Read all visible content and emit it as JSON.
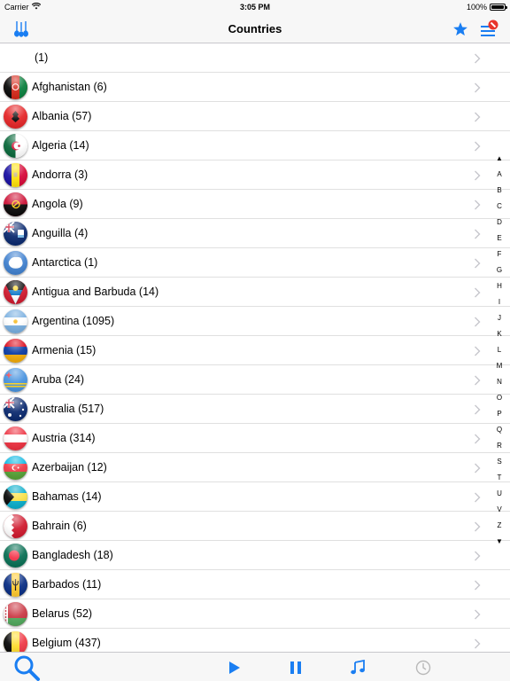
{
  "status": {
    "carrier": "Carrier",
    "time": "3:05 PM",
    "battery": "100%",
    "battery_level": 1.0
  },
  "nav": {
    "title": "Countries",
    "left_icon": "guitars-icon",
    "star_icon": "star-icon",
    "menu_icon": "menu-badge-icon"
  },
  "colors": {
    "accent": "#1a7ef2",
    "separator": "#e0e0e0",
    "chevron": "#c7c7cc"
  },
  "rows": [
    {
      "label": "(1)",
      "flag": "none"
    },
    {
      "label": "Afghanistan (6)",
      "flag": "afghanistan"
    },
    {
      "label": "Albania (57)",
      "flag": "albania"
    },
    {
      "label": "Algeria (14)",
      "flag": "algeria"
    },
    {
      "label": "Andorra (3)",
      "flag": "andorra"
    },
    {
      "label": "Angola (9)",
      "flag": "angola"
    },
    {
      "label": "Anguilla (4)",
      "flag": "anguilla"
    },
    {
      "label": "Antarctica (1)",
      "flag": "antarctica"
    },
    {
      "label": "Antigua and Barbuda (14)",
      "flag": "antigua"
    },
    {
      "label": "Argentina (1095)",
      "flag": "argentina"
    },
    {
      "label": "Armenia (15)",
      "flag": "armenia"
    },
    {
      "label": "Aruba (24)",
      "flag": "aruba"
    },
    {
      "label": "Australia (517)",
      "flag": "australia"
    },
    {
      "label": "Austria (314)",
      "flag": "austria"
    },
    {
      "label": "Azerbaijan (12)",
      "flag": "azerbaijan"
    },
    {
      "label": "Bahamas (14)",
      "flag": "bahamas"
    },
    {
      "label": "Bahrain (6)",
      "flag": "bahrain"
    },
    {
      "label": "Bangladesh (18)",
      "flag": "bangladesh"
    },
    {
      "label": "Barbados (11)",
      "flag": "barbados"
    },
    {
      "label": "Belarus (52)",
      "flag": "belarus"
    },
    {
      "label": "Belgium (437)",
      "flag": "belgium"
    }
  ],
  "index": {
    "up": "▲",
    "down": "▼",
    "letters": [
      "A",
      "B",
      "C",
      "D",
      "E",
      "F",
      "G",
      "H",
      "I",
      "J",
      "K",
      "L",
      "M",
      "N",
      "O",
      "P",
      "Q",
      "R",
      "S",
      "T",
      "U",
      "V",
      "Z"
    ]
  },
  "tabs": [
    "search-icon",
    "play-icon",
    "pause-icon",
    "music-note-icon",
    "clock-icon"
  ]
}
